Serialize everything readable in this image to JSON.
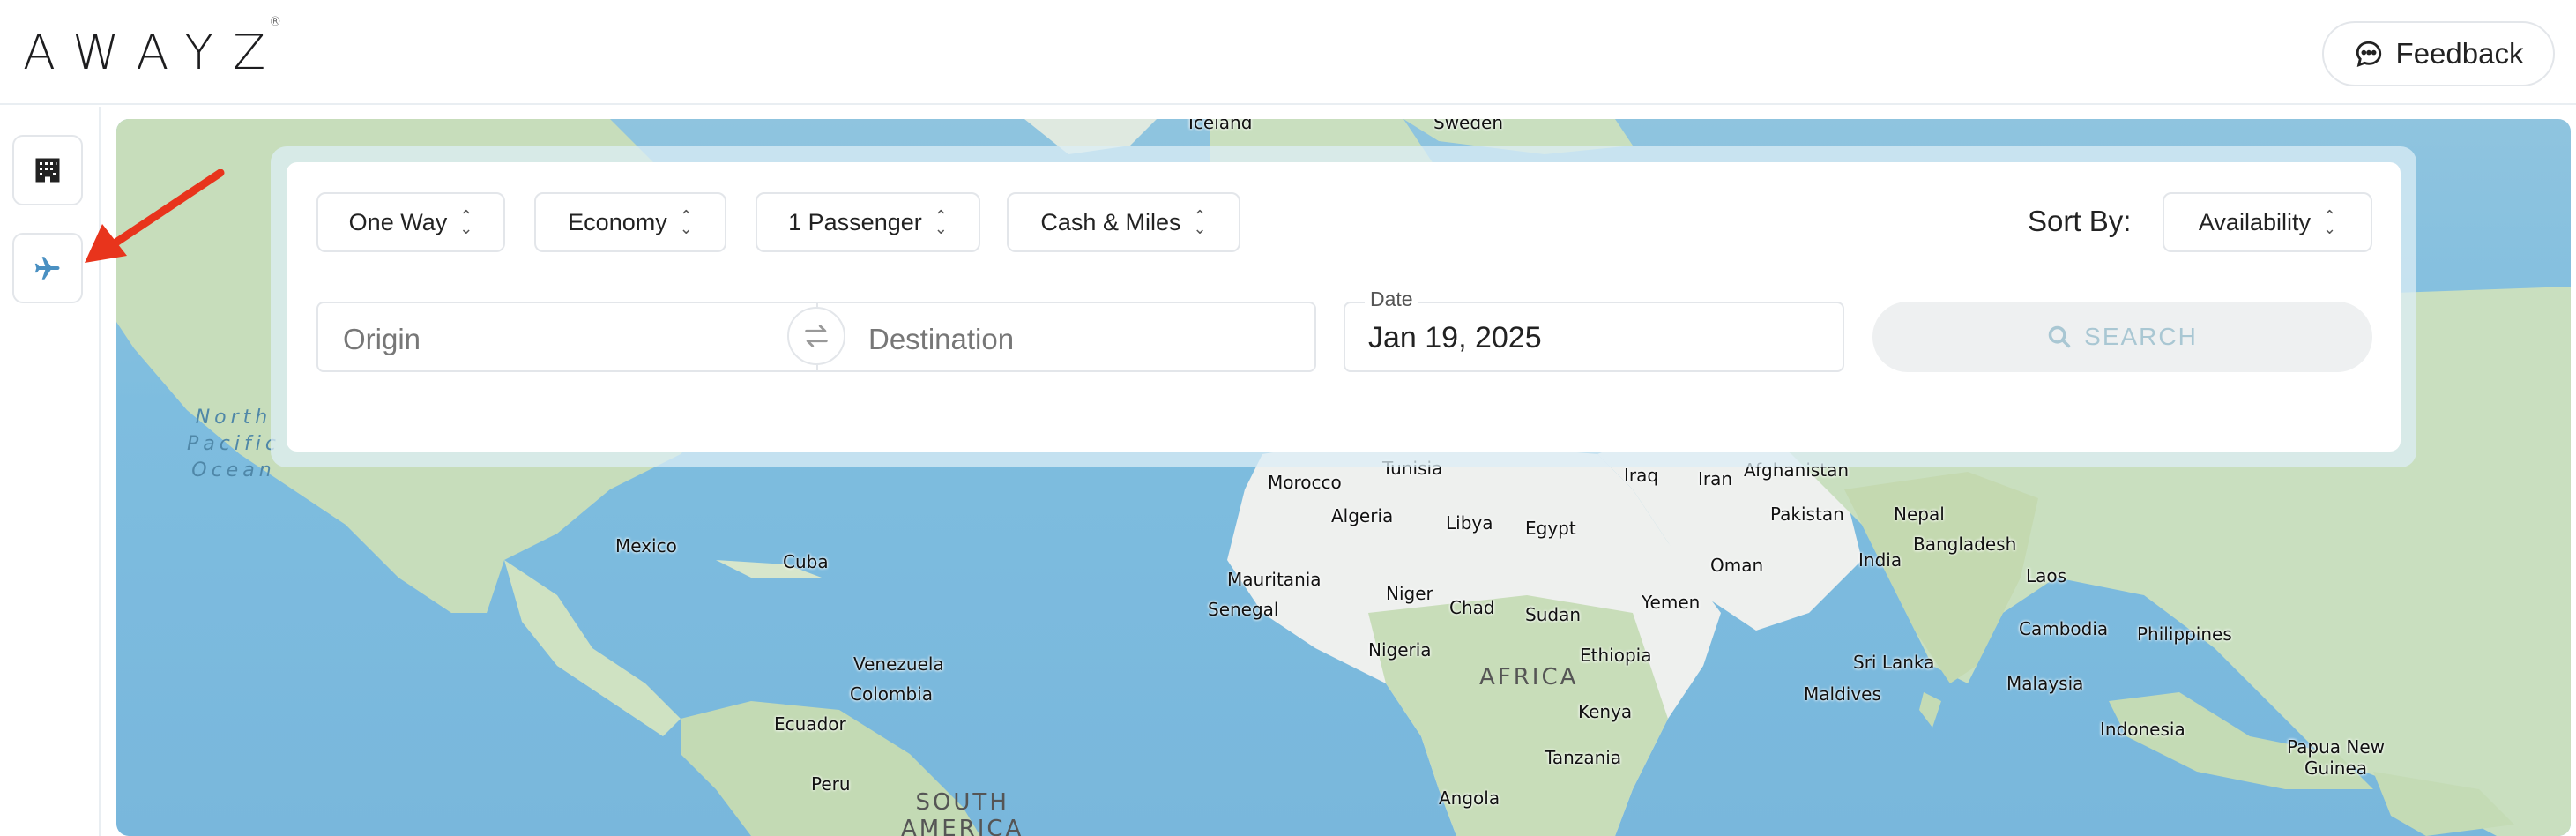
{
  "header": {
    "logo": "AWAYZ",
    "logo_mark": "®",
    "feedback_label": "Feedback"
  },
  "rail": {
    "hotels_icon": "hotel-building-icon",
    "flights_icon": "airplane-icon",
    "active": "flights"
  },
  "search": {
    "trip_type": "One Way",
    "cabin": "Economy",
    "passengers": "1 Passenger",
    "payment": "Cash & Miles",
    "sort_label": "Sort By:",
    "sort_value": "Availability",
    "origin_placeholder": "Origin",
    "destination_placeholder": "Destination",
    "date_label": "Date",
    "date_value": "Jan 19, 2025",
    "search_label": "SEARCH"
  },
  "map": {
    "labels": {
      "iceland": "Iceland",
      "sweden": "Sweden",
      "north_pacific": "North\nPacific\nOcean",
      "tunisia": "Tunisia",
      "iraq": "Iraq",
      "iran": "Iran",
      "afghanistan": "Afghanistan",
      "morocco": "Morocco",
      "algeria": "Algeria",
      "libya": "Libya",
      "egypt": "Egypt",
      "pakistan": "Pakistan",
      "nepal": "Nepal",
      "bangladesh": "Bangladesh",
      "mexico": "Mexico",
      "cuba": "Cuba",
      "india": "India",
      "oman": "Oman",
      "laos": "Laos",
      "mauritania": "Mauritania",
      "niger": "Niger",
      "senegal": "Senegal",
      "chad": "Chad",
      "sudan": "Sudan",
      "yemen": "Yemen",
      "cambodia": "Cambodia",
      "philippines": "Philippines",
      "venezuela": "Venezuela",
      "nigeria": "Nigeria",
      "ethiopia": "Ethiopia",
      "africa": "AFRICA",
      "sri_lanka": "Sri Lanka",
      "colombia": "Colombia",
      "malaysia": "Malaysia",
      "maldives": "Maldives",
      "ecuador": "Ecuador",
      "kenya": "Kenya",
      "indonesia": "Indonesia",
      "tanzania": "Tanzania",
      "papua_new_guinea": "Papua New\nGuinea",
      "peru": "Peru",
      "south_america": "SOUTH\nAMERICA",
      "angola": "Angola"
    }
  },
  "colors": {
    "accent": "#4a90c2",
    "annotation_arrow": "#e8341c",
    "ocean": "#7ebddf",
    "land": "#c9dfbf"
  }
}
